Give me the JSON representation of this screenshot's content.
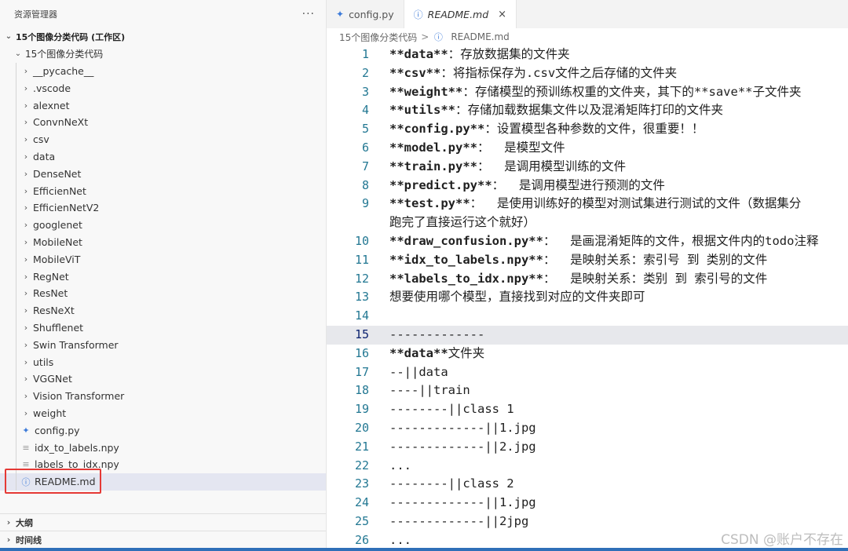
{
  "explorer": {
    "title": "资源管理器",
    "more": "···",
    "workspace": "15个图像分类代码 (工作区)",
    "root": "15个图像分类代码",
    "folders": [
      "__pycache__",
      ".vscode",
      "alexnet",
      "ConvnNeXt",
      "csv",
      "data",
      "DenseNet",
      "EfficienNet",
      "EfficienNetV2",
      "googlenet",
      "MobileNet",
      "MobileViT",
      "RegNet",
      "ResNet",
      "ResNeXt",
      "Shufflenet",
      "Swin Transformer",
      "utils",
      "VGGNet",
      "Vision Transformer",
      "weight"
    ],
    "files": [
      {
        "name": "config.py",
        "icon": "python-icon"
      },
      {
        "name": "idx_to_labels.npy",
        "icon": "file-lines-icon"
      },
      {
        "name": "labels_to_idx.npy",
        "icon": "file-lines-icon"
      },
      {
        "name": "README.md",
        "icon": "info-icon"
      }
    ],
    "outline": "大纲",
    "timeline": "时间线"
  },
  "tabs": [
    {
      "label": "config.py",
      "icon": "python-icon"
    },
    {
      "label": "README.md",
      "icon": "info-icon",
      "close": "×"
    }
  ],
  "breadcrumb": {
    "folder": "15个图像分类代码",
    "sep": ">",
    "file": "README.md"
  },
  "editor": {
    "current_line": 15,
    "lines": [
      {
        "n": "1",
        "b": "**data**",
        "t": "：存放数据集的文件夹"
      },
      {
        "n": "2",
        "b": "**csv**",
        "t": "：将指标保存为.csv文件之后存储的文件夹"
      },
      {
        "n": "3",
        "b": "**weight**",
        "t": "：存储模型的预训练权重的文件夹，其下的**save**子文件夹"
      },
      {
        "n": "4",
        "b": "**utils**",
        "t": "：存储加载数据集文件以及混淆矩阵打印的文件夹"
      },
      {
        "n": "5",
        "b": "**config.py**",
        "t": "：设置模型各种参数的文件，很重要！！"
      },
      {
        "n": "6",
        "b": "**model.py**",
        "t": "：  是模型文件"
      },
      {
        "n": "7",
        "b": "**train.py**",
        "t": "：  是调用模型训练的文件"
      },
      {
        "n": "8",
        "b": "**predict.py**",
        "t": "：  是调用模型进行预测的文件"
      },
      {
        "n": "9",
        "b": "**test.py**",
        "t": "：  是使用训练好的模型对测试集进行测试的文件（数据集分"
      },
      {
        "n": "",
        "b": "",
        "t": "跑完了直接运行这个就好）"
      },
      {
        "n": "10",
        "b": "**draw_confusion.py**",
        "t": "：  是画混淆矩阵的文件，根据文件内的todo注释"
      },
      {
        "n": "11",
        "b": "**idx_to_labels.npy**",
        "t": "：  是映射关系：索引号 到 类别的文件"
      },
      {
        "n": "12",
        "b": "**labels_to_idx.npy**",
        "t": "：  是映射关系：类别 到 索引号的文件"
      },
      {
        "n": "13",
        "b": "",
        "t": "想要使用哪个模型，直接找到对应的文件夹即可"
      },
      {
        "n": "14",
        "b": "",
        "t": ""
      },
      {
        "n": "15",
        "b": "",
        "t": "-------------"
      },
      {
        "n": "16",
        "b": "**data**",
        "t": "文件夹"
      },
      {
        "n": "17",
        "b": "",
        "t": "--||data"
      },
      {
        "n": "18",
        "b": "",
        "t": "----||train"
      },
      {
        "n": "19",
        "b": "",
        "t": "--------||class 1"
      },
      {
        "n": "20",
        "b": "",
        "t": "-------------||1.jpg"
      },
      {
        "n": "21",
        "b": "",
        "t": "-------------||2.jpg"
      },
      {
        "n": "22",
        "b": "",
        "t": "..."
      },
      {
        "n": "23",
        "b": "",
        "t": "--------||class 2"
      },
      {
        "n": "24",
        "b": "",
        "t": "-------------||1.jpg"
      },
      {
        "n": "25",
        "b": "",
        "t": "-------------||2jpg"
      },
      {
        "n": "26",
        "b": "",
        "t": "..."
      }
    ]
  },
  "watermark": "CSDN @账户不存在",
  "colors": {
    "accent": "#2f6fb8",
    "highlight": "#e53935",
    "selection": "#e4e6f1"
  }
}
